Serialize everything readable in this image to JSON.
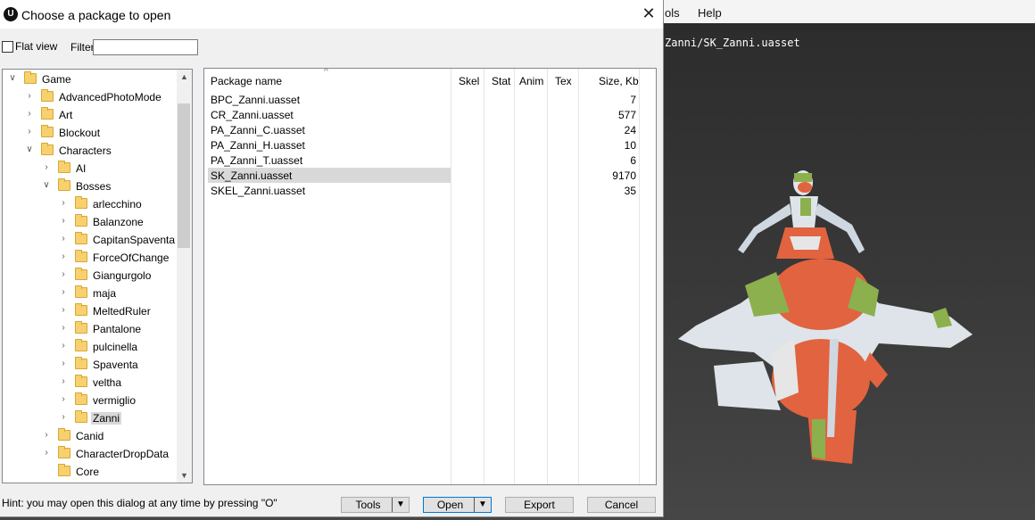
{
  "viewer": {
    "menu": [
      "ols",
      "Help"
    ],
    "path": "Zanni/SK_Zanni.uasset"
  },
  "dialog": {
    "title": "Choose a package to open",
    "close_icon": "close-icon",
    "flat_view_label": "Flat view",
    "flat_view_checked": false,
    "filter_label": "Filter:",
    "filter_value": "",
    "tree": [
      {
        "label": "Game",
        "level": 0,
        "expander": "down"
      },
      {
        "label": "AdvancedPhotoMode",
        "level": 1,
        "expander": "right"
      },
      {
        "label": "Art",
        "level": 1,
        "expander": "right"
      },
      {
        "label": "Blockout",
        "level": 1,
        "expander": "right"
      },
      {
        "label": "Characters",
        "level": 1,
        "expander": "down"
      },
      {
        "label": "AI",
        "level": 2,
        "expander": "right"
      },
      {
        "label": "Bosses",
        "level": 2,
        "expander": "down"
      },
      {
        "label": "arlecchino",
        "level": 3,
        "expander": "right"
      },
      {
        "label": "Balanzone",
        "level": 3,
        "expander": "right"
      },
      {
        "label": "CapitanSpaventa",
        "level": 3,
        "expander": "right"
      },
      {
        "label": "ForceOfChange",
        "level": 3,
        "expander": "right"
      },
      {
        "label": "Giangurgolo",
        "level": 3,
        "expander": "right"
      },
      {
        "label": "maja",
        "level": 3,
        "expander": "right"
      },
      {
        "label": "MeltedRuler",
        "level": 3,
        "expander": "right"
      },
      {
        "label": "Pantalone",
        "level": 3,
        "expander": "right"
      },
      {
        "label": "pulcinella",
        "level": 3,
        "expander": "right"
      },
      {
        "label": "Spaventa",
        "level": 3,
        "expander": "right"
      },
      {
        "label": "veltha",
        "level": 3,
        "expander": "right"
      },
      {
        "label": "vermiglio",
        "level": 3,
        "expander": "right"
      },
      {
        "label": "Zanni",
        "level": 3,
        "expander": "right",
        "selected": true
      },
      {
        "label": "Canid",
        "level": 2,
        "expander": "right"
      },
      {
        "label": "CharacterDropData",
        "level": 2,
        "expander": "right"
      },
      {
        "label": "Core",
        "level": 2,
        "expander": "none"
      }
    ],
    "columns": [
      "Package name",
      "Skel",
      "Stat",
      "Anim",
      "Tex",
      "Size, Kb"
    ],
    "files": [
      {
        "name": "BPC_Zanni.uasset",
        "size": "7"
      },
      {
        "name": "CR_Zanni.uasset",
        "size": "577"
      },
      {
        "name": "PA_Zanni_C.uasset",
        "size": "24"
      },
      {
        "name": "PA_Zanni_H.uasset",
        "size": "10"
      },
      {
        "name": "PA_Zanni_T.uasset",
        "size": "6"
      },
      {
        "name": "SK_Zanni.uasset",
        "size": "9170",
        "selected": true
      },
      {
        "name": "SKEL_Zanni.uasset",
        "size": "35"
      }
    ],
    "hint": "Hint: you may open this dialog at any time by pressing \"O\"",
    "buttons": {
      "tools": "Tools",
      "open": "Open",
      "export": "Export",
      "cancel": "Cancel"
    }
  }
}
